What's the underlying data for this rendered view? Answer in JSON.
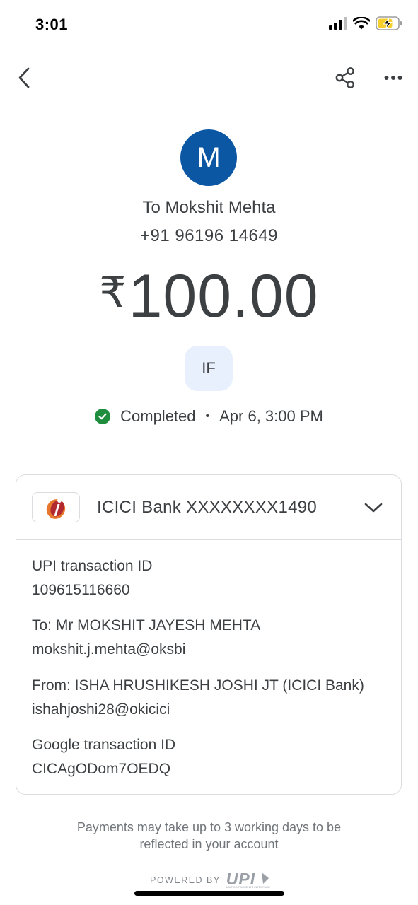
{
  "status_bar": {
    "time": "3:01",
    "icons": [
      "cellular-signal-icon",
      "wifi-icon",
      "battery-charging-icon"
    ]
  },
  "top_bar": {
    "icons": [
      "back-arrow-icon",
      "share-icon",
      "more-options-icon"
    ]
  },
  "payee": {
    "avatar_initial": "M",
    "avatar_color": "#0b57a4",
    "name": "To Mokshit Mehta",
    "phone": "+91 96196 14649"
  },
  "payment": {
    "currency_symbol": "₹",
    "amount": "100.00",
    "sender_initials": "IF",
    "status": "Completed",
    "separator": "•",
    "datetime": "Apr 6, 3:00 PM",
    "status_color": "#1e8e3e"
  },
  "card": {
    "bank_account": "ICICI Bank XXXXXXXX1490",
    "bank_logo_icon": "icici-bank-logo-icon",
    "details": [
      {
        "label": "UPI transaction ID",
        "value": "109615116660"
      },
      {
        "label": "To: Mr MOKSHIT JAYESH MEHTA",
        "value": "mokshit.j.mehta@oksbi"
      },
      {
        "label": "From: ISHA HRUSHIKESH JOSHI JT (ICICI Bank)",
        "value": "ishahjoshi28@okicici"
      },
      {
        "label": "Google transaction ID",
        "value": "CICAgODom7OEDQ"
      }
    ]
  },
  "footer": {
    "note_line1": "Payments may take up to 3 working days to be",
    "note_line2": "reflected in your account",
    "powered_by": "POWERED BY",
    "upi_logo_text": "UPI",
    "upi_tagline": "UNIFIED PAYMENTS INTERFACE"
  }
}
